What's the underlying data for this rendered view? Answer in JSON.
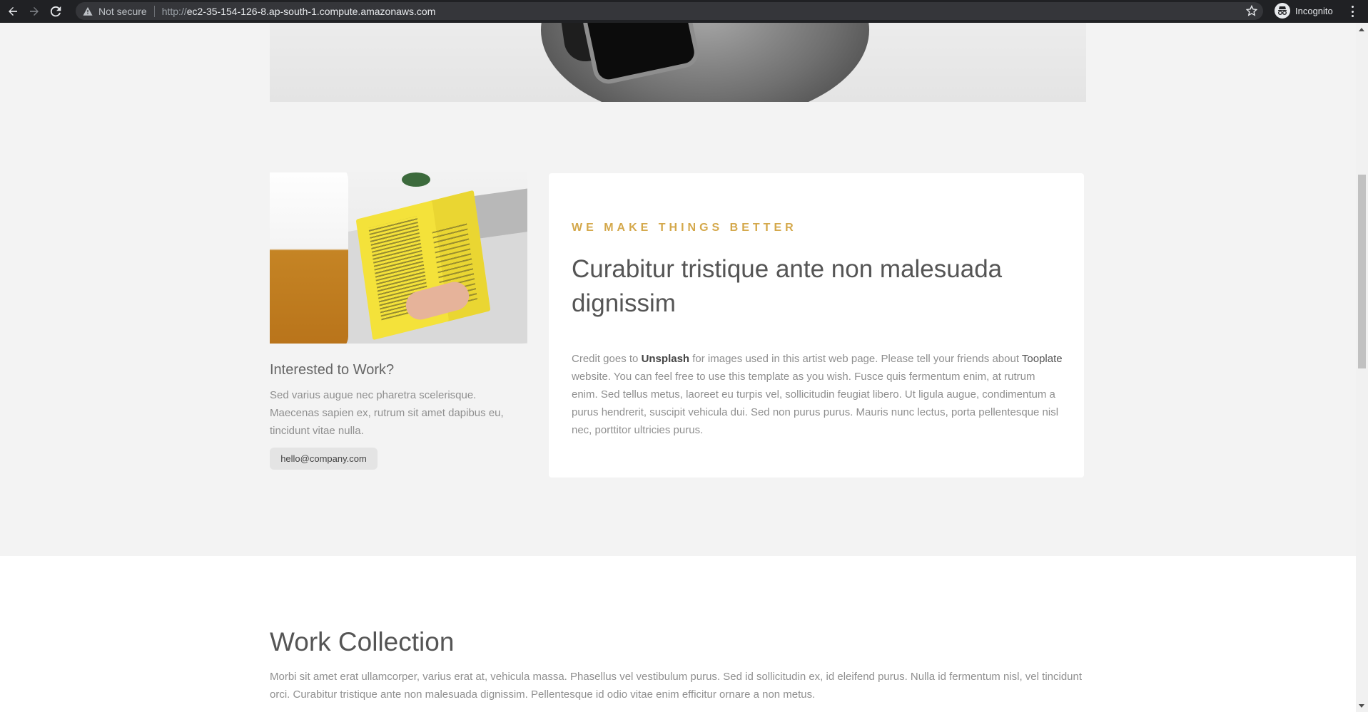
{
  "browser": {
    "security_label": "Not secure",
    "url_scheme": "http://",
    "url_host": "ec2-35-154-126-8.ap-south-1.compute.amazonaws.com",
    "profile_label": "Incognito",
    "icons": [
      "back-arrow-icon",
      "forward-arrow-icon",
      "reload-icon",
      "warning-icon",
      "star-icon",
      "incognito-icon",
      "kebab-menu-icon"
    ]
  },
  "about": {
    "interested_title": "Interested to Work?",
    "interested_text": "Sed varius augue nec pharetra scelerisque. Maecenas sapien ex, rutrum sit amet dapibus eu, tincidunt vitae nulla.",
    "email": "hello@company.com",
    "eyebrow": "WE MAKE THINGS BETTER",
    "heading": "Curabitur tristique ante non malesuada dignissim",
    "body_intro": "Credit goes to",
    "body_unsplash": "Unsplash",
    "body_middle": "for images used in this artist web page. Please tell your friends about",
    "body_tooplate": "Tooplate",
    "body_rest": "website. You can feel free to use this template as you wish. Fusce quis fermentum enim, at rutrum enim. Sed tellus metus, laoreet eu turpis vel, sollicitudin feugiat libero. Ut ligula augue, condimentum a purus hendrerit, suscipit vehicula dui. Sed non purus purus. Mauris nunc lectus, porta pellentesque nisl nec, porttitor ultricies purus.",
    "accent_color": "#d4a84b"
  },
  "work_collection": {
    "title": "Work Collection",
    "text": "Morbi sit amet erat ullamcorper, varius erat at, vehicula massa. Phasellus vel vestibulum purus. Sed id sollicitudin ex, id eleifend purus. Nulla id fermentum nisl, vel tincidunt orci. Curabitur tristique ante non malesuada dignissim. Pellentesque id odio vitae enim efficitur ornare a non metus."
  }
}
